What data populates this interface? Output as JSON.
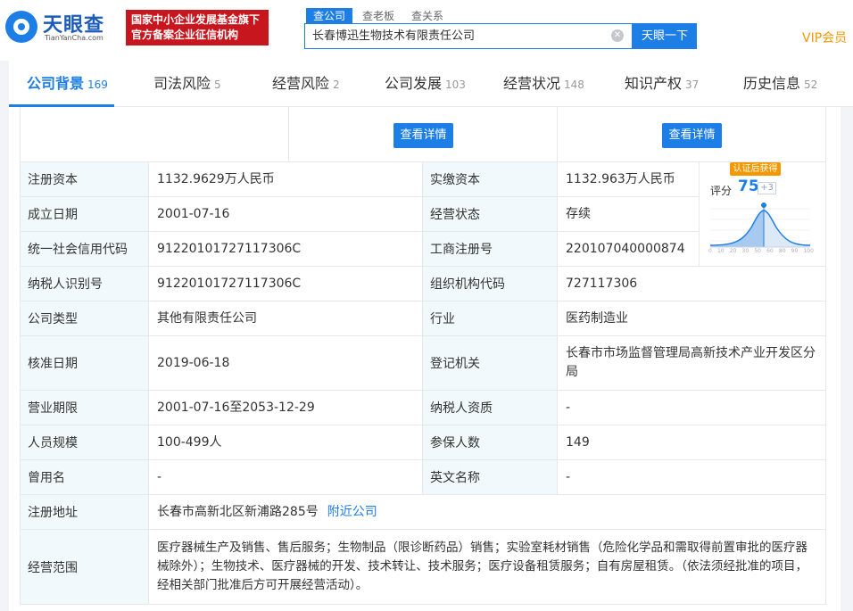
{
  "header": {
    "logo_cn": "天眼查",
    "logo_en": "TianYanCha.com",
    "badge_line1": "国家中小企业发展基金旗下",
    "badge_line2": "官方备案企业征信机构",
    "search_tabs": [
      "查公司",
      "查老板",
      "查关系"
    ],
    "search_value": "长春博迅生物技术有限责任公司",
    "search_button": "天眼一下",
    "vip": "VIP会员"
  },
  "nav": {
    "tabs": [
      {
        "label": "公司背景",
        "count": "169"
      },
      {
        "label": "司法风险",
        "count": "5"
      },
      {
        "label": "经营风险",
        "count": "2"
      },
      {
        "label": "公司发展",
        "count": "103"
      },
      {
        "label": "经营状况",
        "count": "148"
      },
      {
        "label": "知识产权",
        "count": "37"
      },
      {
        "label": "历史信息",
        "count": "52"
      }
    ]
  },
  "detail_button": "查看详情",
  "score": {
    "badge": "认证后获得",
    "label": "评分",
    "value": "75",
    "plus": "+3",
    "axis": [
      "0",
      "10",
      "20",
      "30",
      "50",
      "60",
      "80",
      "90",
      "100"
    ]
  },
  "info": {
    "reg_capital_label": "注册资本",
    "reg_capital": "1132.9629万人民币",
    "paid_capital_label": "实缴资本",
    "paid_capital": "1132.963万人民币",
    "founded_label": "成立日期",
    "founded": "2001-07-16",
    "status_label": "经营状态",
    "status": "存续",
    "credit_code_label": "统一社会信用代码",
    "credit_code": "91220101727117306C",
    "biz_reg_label": "工商注册号",
    "biz_reg": "220107040000874",
    "tax_id_label": "纳税人识别号",
    "tax_id": "91220101727117306C",
    "org_code_label": "组织机构代码",
    "org_code": "727117306",
    "company_type_label": "公司类型",
    "company_type": "其他有限责任公司",
    "industry_label": "行业",
    "industry": "医药制造业",
    "approved_label": "核准日期",
    "approved": "2019-06-18",
    "authority_label": "登记机关",
    "authority": "长春市市场监督管理局高新技术产业开发区分局",
    "term_label": "营业期限",
    "term": "2001-07-16至2053-12-29",
    "taxpayer_label": "纳税人资质",
    "taxpayer": "-",
    "staff_label": "人员规模",
    "staff": "100-499人",
    "insured_label": "参保人数",
    "insured": "149",
    "former_name_label": "曾用名",
    "former_name": "-",
    "english_name_label": "英文名称",
    "english_name": "-",
    "address_label": "注册地址",
    "address": "长春市高新北区新浦路285号",
    "nearby": "附近公司",
    "scope_label": "经营范围",
    "scope": "医疗器械生产及销售、售后服务；生物制品（限诊断药品）销售；实验室耗材销售（危险化学品和需取得前置审批的医疗器械除外）；生物技术、医疗器械的开发、技术转让、技术服务；医疗设备租赁服务；自有房屋租赁。（依法须经批准的项目，经相关部门批准后方可开展经营活动）。"
  }
}
